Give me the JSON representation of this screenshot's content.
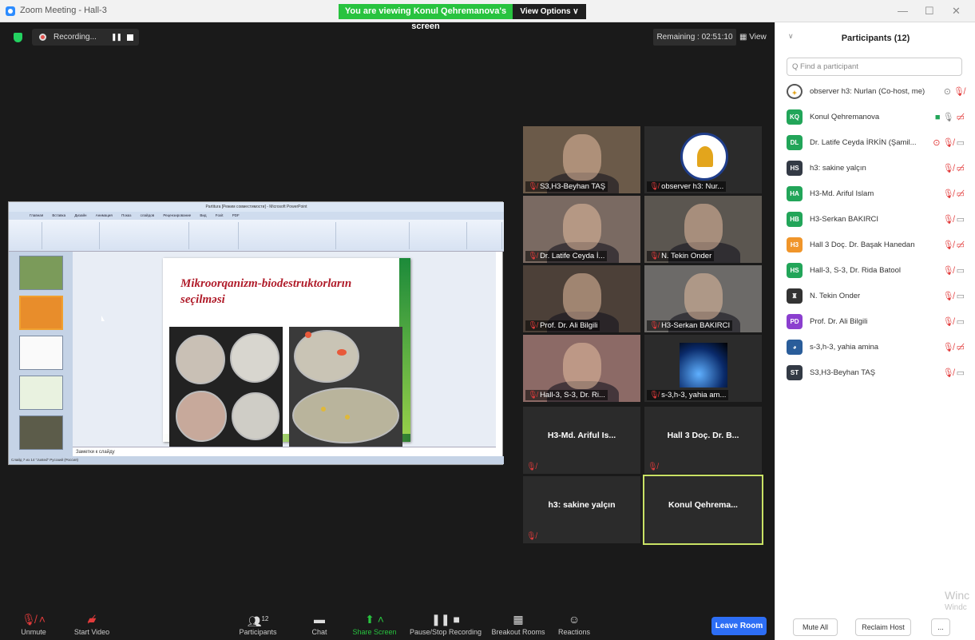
{
  "window": {
    "title": "Zoom Meeting - Hall-3",
    "banner": "You are viewing Konul Qehremanova's screen",
    "view_options": "View Options ∨",
    "minimize": "—",
    "maximize": "☐",
    "close": "✕"
  },
  "meeting": {
    "recording_label": "Recording...",
    "remaining": "Remaining : 02:51:10",
    "view_label": "View"
  },
  "slide": {
    "app_title": "Partitura [Режим совместимости] - Microsoft PowerPoint",
    "ribbon_tabs": "Главная Вставка Дизайн Анимация Показ слайдов Рецензирование Вид Foxit PDF",
    "title": "Mikroorqanizm-biodestruktorların seçilməsi",
    "notes": "Заметки к слайду",
    "status": "Слайд 7 из 14    \"Justed\"    Русский (Россия)"
  },
  "tiles": [
    {
      "name": "S3,H3-Beyhan TAŞ",
      "kind": "video",
      "bg": "#6b5a49"
    },
    {
      "name": "observer h3: Nur...",
      "kind": "logo",
      "bg": "#2b2b2b"
    },
    {
      "name": "Dr. Latife Ceyda İ...",
      "kind": "video",
      "bg": "#7a6a62"
    },
    {
      "name": "N. Tekin Onder",
      "kind": "video",
      "bg": "#5b5650"
    },
    {
      "name": "Prof. Dr. Ali Bilgili",
      "kind": "video",
      "bg": "#4c4038"
    },
    {
      "name": "H3-Serkan BAKIRCI",
      "kind": "video",
      "bg": "#6c6a68"
    },
    {
      "name": "Hall-3, S-3, Dr. Ri...",
      "kind": "video",
      "bg": "#8c6a66"
    },
    {
      "name": "s-3,h-3, yahia am...",
      "kind": "earth",
      "bg": "#2b2b2b"
    },
    {
      "name": "H3-Md. Ariful Is...",
      "kind": "name",
      "bg": "#2b2b2b"
    },
    {
      "name": "Hall 3 Doç. Dr. B...",
      "kind": "name",
      "bg": "#2b2b2b"
    },
    {
      "name": "h3: sakine yalçın",
      "kind": "name",
      "bg": "#2b2b2b"
    },
    {
      "name": "Konul  Qehrema...",
      "kind": "name-active",
      "bg": "#2b2b2b"
    }
  ],
  "toolbar": {
    "unmute": "Unmute",
    "start_video": "Start Video",
    "participants": "Participants",
    "participants_count": "12",
    "chat": "Chat",
    "share_screen": "Share Screen",
    "pause_recording": "Pause/Stop Recording",
    "breakout": "Breakout Rooms",
    "reactions": "Reactions",
    "leave": "Leave Room"
  },
  "panel": {
    "title": "Participants (12)",
    "search_placeholder": "Q Find a participant",
    "mute_all": "Mute All",
    "reclaim_host": "Reclaim Host",
    "more": "..."
  },
  "participants": [
    {
      "initials": "",
      "name": "observer h3: Nurlan (Co-host, me)",
      "color": "#ffffff",
      "icons": "rec-mute"
    },
    {
      "initials": "KQ",
      "name": "Konul Qehremanova",
      "color": "#22a559",
      "icons": "share-mic-camoff"
    },
    {
      "initials": "DL",
      "name": "Dr. Latife Ceyda İRKİN (Şamil...",
      "color": "#22a559",
      "icons": "rec-mute-cam"
    },
    {
      "initials": "HS",
      "name": "h3: sakine yalçın",
      "color": "#333a45",
      "icons": "mute-camoff"
    },
    {
      "initials": "HA",
      "name": "H3-Md. Ariful Islam",
      "color": "#22a559",
      "icons": "mute-camoff"
    },
    {
      "initials": "HB",
      "name": "H3-Serkan BAKIRCI",
      "color": "#22a559",
      "icons": "mute-cam"
    },
    {
      "initials": "H3",
      "name": "Hall 3 Doç. Dr. Başak Hanedan",
      "color": "#f0952a",
      "icons": "mute-camoff"
    },
    {
      "initials": "HS",
      "name": "Hall-3, S-3, Dr. Rida Batool",
      "color": "#22a559",
      "icons": "mute-cam"
    },
    {
      "initials": "",
      "name": "N. Tekin Onder",
      "color": "#333333",
      "icons": "mute-cam"
    },
    {
      "initials": "PD",
      "name": "Prof. Dr. Ali Bilgili",
      "color": "#8b3fcf",
      "icons": "mute-cam"
    },
    {
      "initials": "",
      "name": "s-3,h-3, yahia amina",
      "color": "#2a5d9a",
      "icons": "mute-camoff"
    },
    {
      "initials": "ST",
      "name": "S3,H3-Beyhan TAŞ",
      "color": "#333a45",
      "icons": "mute-cam"
    }
  ],
  "watermark": {
    "line1": "Winc",
    "line2": "Windc"
  }
}
